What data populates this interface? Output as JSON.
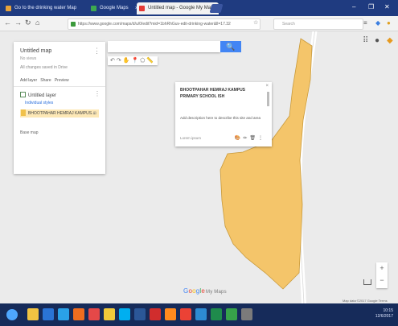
{
  "browser": {
    "tabs": [
      {
        "label": "Go to the drinking water Map",
        "active": false,
        "favicon_color": "#e8a33a"
      },
      {
        "label": "Google Maps",
        "active": false,
        "favicon_color": "#3da84f"
      },
      {
        "label": "Untitled map - Google My Maps",
        "active": true,
        "favicon_color": "#e53935"
      }
    ],
    "window_controls": {
      "minimize": "–",
      "maximize": "❐",
      "close": "✕"
    },
    "nav": {
      "back": "←",
      "forward": "→",
      "reload": "↻",
      "home": "⌂"
    },
    "url": "https://www.google.com/maps/d/u/0/edit?mid=1bhRhGuv-edit-drinking-water&ll=17.32",
    "search_placeholder": "Search",
    "toolbar_icons": {
      "star": "☆",
      "menu": "≡",
      "extension": "◆",
      "profile": "●"
    }
  },
  "map": {
    "panel": {
      "title": "Untitled map",
      "subtitle": "No views",
      "last_edit": "All changes saved in Drive",
      "more": "⋮",
      "actions": {
        "add_layer": "Add layer",
        "share": "Share",
        "preview": "Preview"
      },
      "layer_name": "Untitled layer",
      "layer_more": "⋮",
      "style_link": "Individual styles",
      "item_label": "BHOOTPAHAR HEMRAJ KAMPUS...",
      "item_icon": "⊞",
      "base_map": "Base map"
    },
    "search": {
      "placeholder": "",
      "button_icon": "🔍"
    },
    "tools": [
      "↶",
      "↷",
      "✋",
      "📍",
      "⬠",
      "📏"
    ],
    "card": {
      "title": "BHOOTPAHAR HEMRAJ KAMPUS PRIMARY SCHOOL ISH",
      "description": "Add description here to describe this site and area",
      "footer": "Lorem ipsum",
      "tools": [
        "🎨",
        "✏",
        "🗑",
        "⋮"
      ],
      "close": "×"
    },
    "topright_icons": {
      "grid": "⠿",
      "profile": "●",
      "apps": "◆"
    },
    "zoom": {
      "in": "+",
      "out": "−"
    },
    "google_logo": [
      {
        "t": "G",
        "c": "#4285f4"
      },
      {
        "t": "o",
        "c": "#ea4335"
      },
      {
        "t": "o",
        "c": "#fbbc05"
      },
      {
        "t": "g",
        "c": "#4285f4"
      },
      {
        "t": "l",
        "c": "#34a853"
      },
      {
        "t": "e",
        "c": "#ea4335"
      }
    ],
    "google_sub": "My Maps",
    "attribution": "Map data ©2017 Google  Terms",
    "polygon_fill": "#f4c56a",
    "road_color": "#ffffff"
  },
  "taskbar": {
    "tray_time": "10:15",
    "tray_date": "12/6/2017",
    "icons": [
      {
        "name": "file-explorer",
        "color": "#f2c442"
      },
      {
        "name": "ie-browser",
        "color": "#2a74d6"
      },
      {
        "name": "windows-store",
        "color": "#2aa1e8"
      },
      {
        "name": "media-player",
        "color": "#ef6d1f"
      },
      {
        "name": "paint-app",
        "color": "#e54848"
      },
      {
        "name": "chrome-browser",
        "color": "#f0c93a"
      },
      {
        "name": "skype-app",
        "color": "#00aff0"
      },
      {
        "name": "word-app",
        "color": "#2b5797"
      },
      {
        "name": "opera-browser",
        "color": "#d12d2d"
      },
      {
        "name": "firefox-browser",
        "color": "#ff8a1e"
      },
      {
        "name": "chrome-alt",
        "color": "#eb4235"
      },
      {
        "name": "photos-app",
        "color": "#2d8bd3"
      },
      {
        "name": "excel-app",
        "color": "#1f8b4c"
      },
      {
        "name": "music-app",
        "color": "#37a34a"
      },
      {
        "name": "camera-app",
        "color": "#7b7b7b"
      }
    ]
  }
}
